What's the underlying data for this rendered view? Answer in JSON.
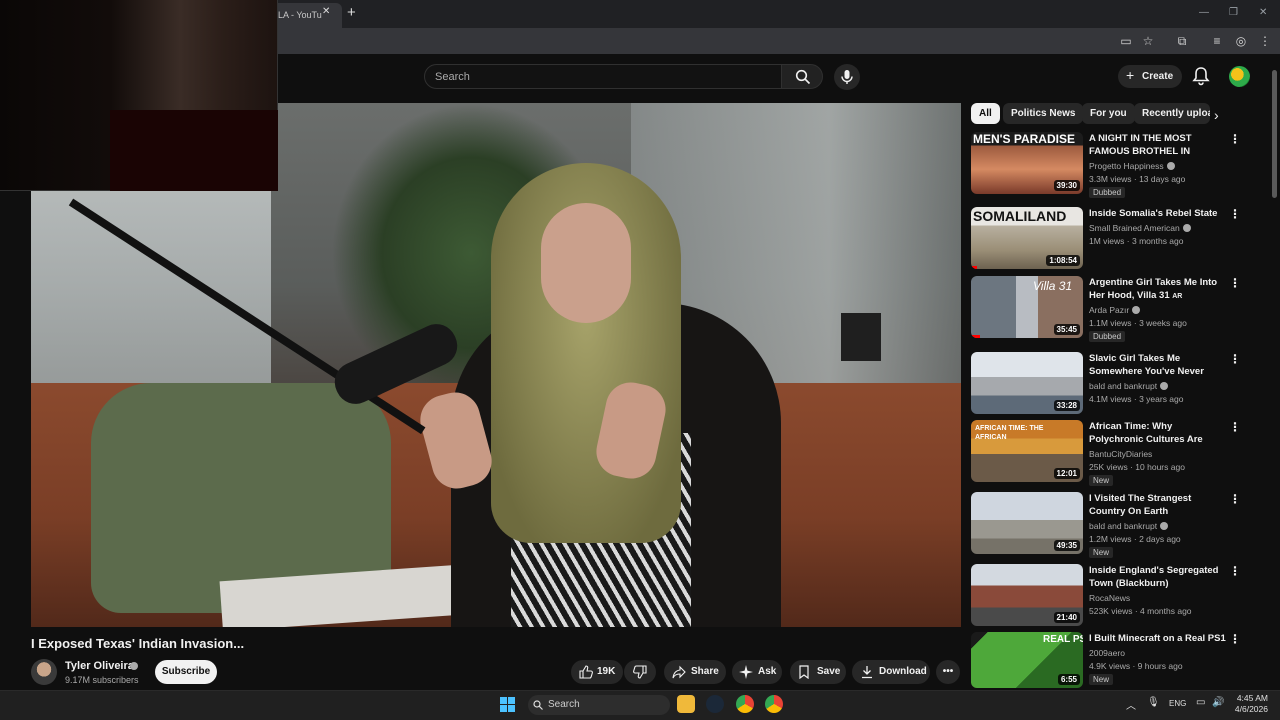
{
  "browser": {
    "tab_title": "LA - YouTu",
    "tab_close": "✕",
    "new_tab": "+"
  },
  "header": {
    "search_placeholder": "Search",
    "create_label": "Create"
  },
  "video": {
    "title": "I Exposed Texas' Indian Invasion...",
    "channel": "Tyler Oliveira",
    "subscribers": "9.17M subscribers",
    "subscribe_label": "Subscribe",
    "likes": "19K",
    "share_label": "Share",
    "ask_label": "Ask",
    "save_label": "Save",
    "download_label": "Download"
  },
  "chips": [
    "All",
    "Politics News",
    "For you",
    "Recently uploa"
  ],
  "recommendations": [
    {
      "title": "A NIGHT IN THE MOST FAMOUS BROTHEL IN EUROPE",
      "title_suffix": "AT",
      "channel": "Progetto Happiness",
      "verified": true,
      "meta": "3.3M views · 13 days ago",
      "badge": "Dubbed",
      "duration": "39:30",
      "thumb_text": "MEN'S PARADISE",
      "progress": 0.0
    },
    {
      "title": "Inside Somalia's Rebel State",
      "title_suffix": "",
      "channel": "Small Brained American",
      "verified": true,
      "meta": "1M views · 3 months ago",
      "badge": "",
      "duration": "1:08:54",
      "thumb_text": "SOMALILAND",
      "progress": 0.05
    },
    {
      "title": "Argentine Girl Takes Me Into Her Hood, Villa 31",
      "title_suffix": "AR",
      "channel": "Arda Pazır",
      "verified": true,
      "meta": "1.1M views · 3 weeks ago",
      "badge": "Dubbed",
      "duration": "35:45",
      "thumb_text": "Villa 31",
      "progress": 0.08
    },
    {
      "title": "Slavic Girl Takes Me Somewhere You've Never Hear...",
      "title_suffix": "",
      "channel": "bald and bankrupt",
      "verified": true,
      "meta": "4.1M views · 3 years ago",
      "badge": "",
      "duration": "33:28",
      "thumb_text": "",
      "progress": 0.0
    },
    {
      "title": "African Time: Why Polychronic Cultures Are Mostly ...",
      "title_suffix": "",
      "channel": "BantuCityDiaries",
      "verified": false,
      "meta": "25K views · 10 hours ago",
      "badge": "New",
      "duration": "12:01",
      "thumb_text": "AFRICAN TIME: THE AFRICAN",
      "progress": 0.0
    },
    {
      "title": "I Visited The Strangest Country On Earth",
      "title_suffix": "",
      "channel": "bald and bankrupt",
      "verified": true,
      "meta": "1.2M views · 2 days ago",
      "badge": "New",
      "duration": "49:35",
      "thumb_text": "",
      "progress": 0.0
    },
    {
      "title": "Inside England's Segregated Town (Blackburn)",
      "title_suffix": "",
      "channel": "RocaNews",
      "verified": false,
      "meta": "523K views · 4 months ago",
      "badge": "",
      "duration": "21:40",
      "thumb_text": "",
      "progress": 0.0
    },
    {
      "title": "I Built Minecraft on a Real PS1",
      "title_suffix": "",
      "channel": "2009aero",
      "verified": false,
      "meta": "4.9K views · 9 hours ago",
      "badge": "New",
      "duration": "6:55",
      "thumb_text": "REAL PS1",
      "progress": 0.0
    }
  ],
  "taskbar": {
    "search_placeholder": "Search",
    "language": "ENG",
    "time": "4:45 AM",
    "date": "4/6/2026"
  },
  "colors": {
    "accent_red": "#ff0000",
    "background": "#0f0f0f",
    "pill": "#272727"
  }
}
